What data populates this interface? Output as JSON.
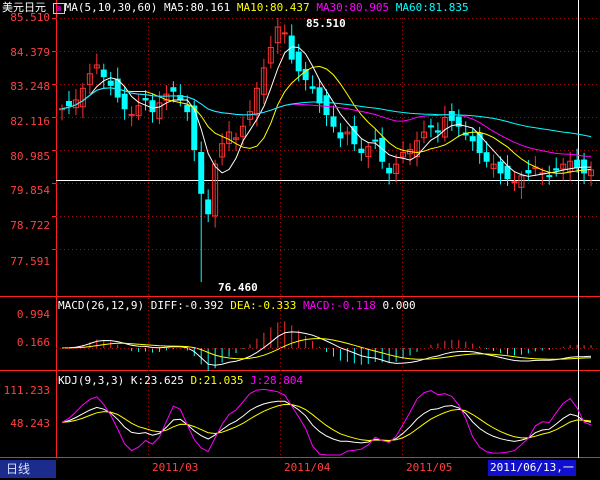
{
  "app": {
    "instrument": "美元日元",
    "period_tab": "日线"
  },
  "price_panel": {
    "ma_icon": "ma-toggle-icon",
    "indicator": "MA(5,10,30,60)",
    "ma5": "MA5:80.161",
    "ma10": "MA10:80.437",
    "ma30": "MA30:80.905",
    "ma60": "MA60:81.835",
    "y_ticks": [
      "85.510",
      "84.379",
      "83.248",
      "82.116",
      "80.985",
      "79.854",
      "78.722",
      "77.591"
    ],
    "high_label": "85.510",
    "low_label": "76.460",
    "colors": {
      "ma5": "#ffffff",
      "ma10": "#ffff00",
      "ma30": "#ff00ff",
      "ma60": "#00ffff",
      "up": "#ff3030",
      "down": "#00ffff",
      "axis": "#ff2020"
    }
  },
  "macd_panel": {
    "indicator": "MACD(26,12,9)",
    "diff": "DIFF:-0.392",
    "dea": "DEA:-0.333",
    "macd": "MACD:-0.118",
    "extra": "0.000",
    "y_ticks": [
      "0.994",
      "0.166"
    ]
  },
  "kdj_panel": {
    "indicator": "KDJ(9,3,3)",
    "k": "K:23.625",
    "d": "D:21.035",
    "j": "J:28.804",
    "y_ticks": [
      "111.233",
      "48.243"
    ]
  },
  "x_axis": {
    "labels": [
      "2011/03",
      "2011/04",
      "2011/05"
    ],
    "cursor_date": "2011/06/13,一"
  },
  "chart_data": {
    "type": "candlestick",
    "ylim": [
      76.46,
      85.51
    ],
    "high": 85.51,
    "low": 76.46,
    "close_series": [
      82.4,
      82.5,
      82.7,
      83.1,
      83.6,
      83.9,
      83.5,
      83.2,
      82.8,
      82.4,
      82.2,
      82.5,
      82.7,
      82.3,
      82.6,
      82.9,
      83.0,
      82.7,
      82.3,
      81.0,
      79.5,
      78.8,
      80.5,
      81.2,
      81.6,
      81.4,
      81.8,
      82.3,
      83.1,
      83.8,
      84.5,
      85.2,
      85.0,
      84.1,
      83.7,
      83.4,
      83.1,
      82.6,
      82.2,
      81.8,
      81.4,
      81.6,
      81.2,
      80.9,
      81.1,
      81.3,
      80.6,
      80.2,
      80.5,
      80.9,
      81.0,
      81.3,
      81.6,
      81.8,
      81.6,
      82.1,
      82.0,
      81.8,
      81.5,
      81.3,
      80.9,
      80.6,
      80.5,
      80.2,
      80.0,
      79.9,
      80.1,
      80.2,
      80.4,
      80.2,
      80.1,
      80.3,
      80.5,
      80.6,
      80.4,
      80.2,
      80.3
    ]
  }
}
